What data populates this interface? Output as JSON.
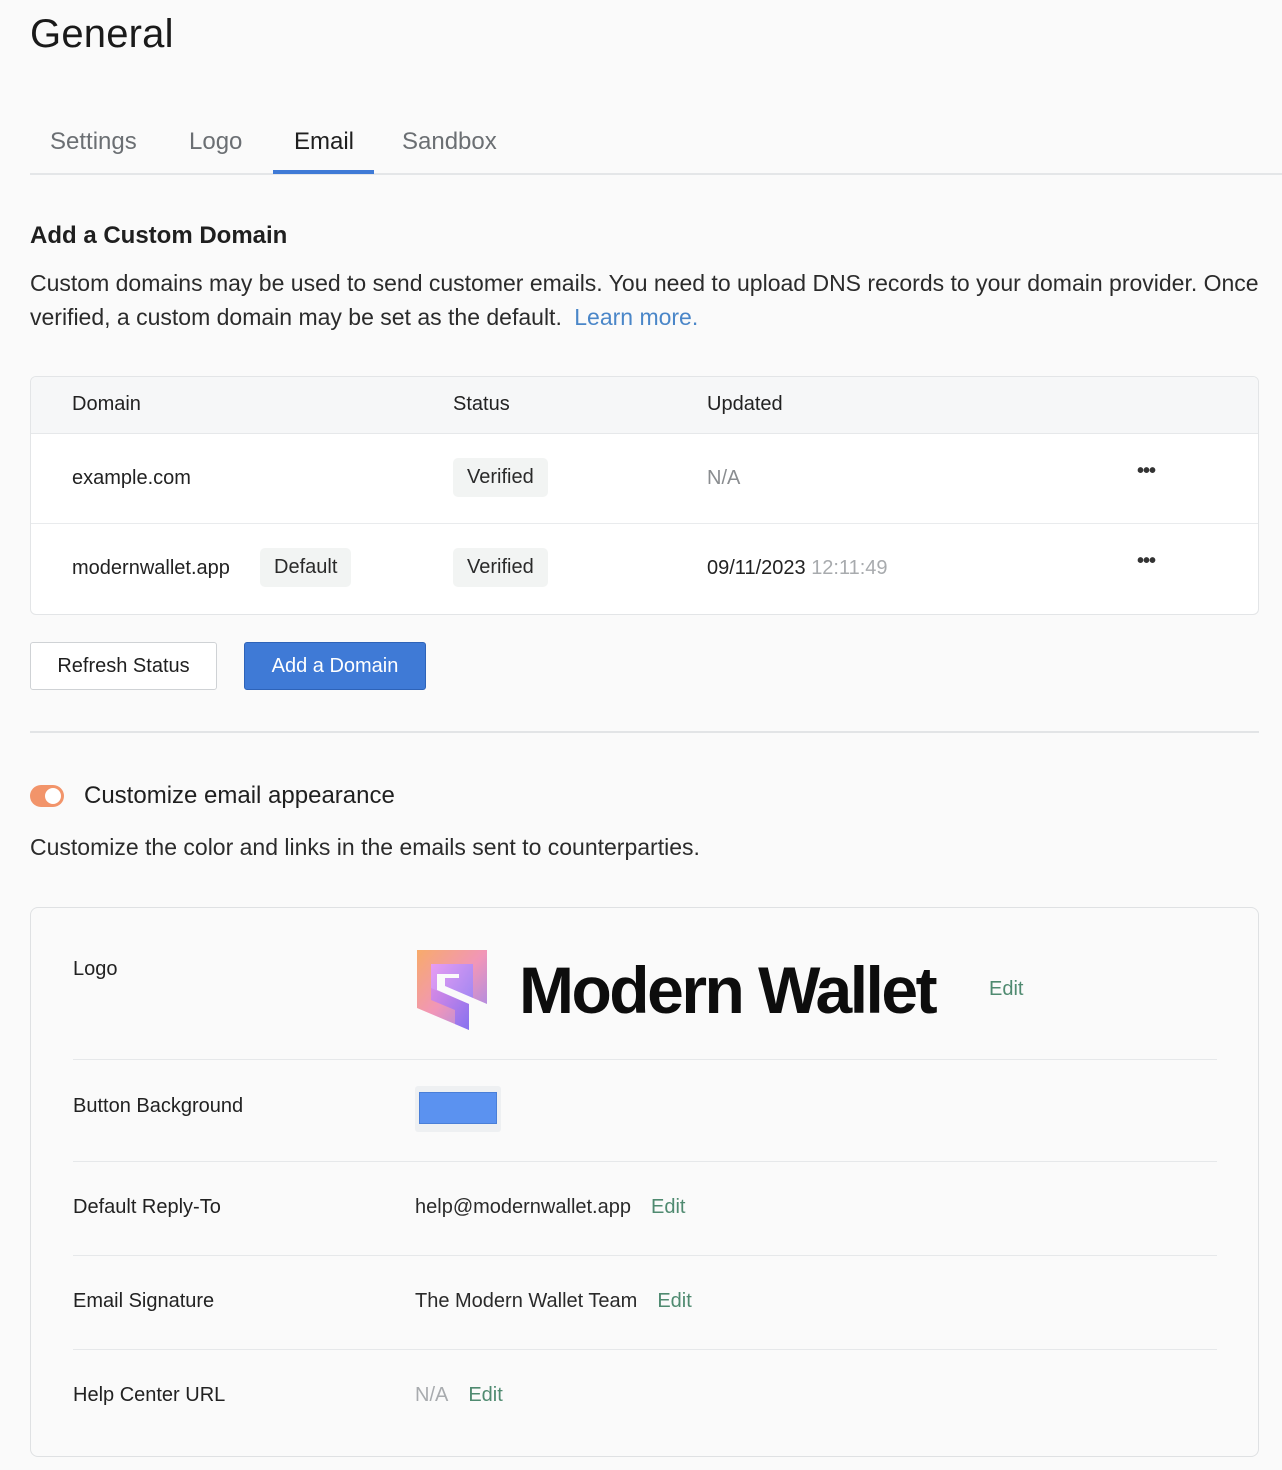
{
  "page": {
    "title": "General"
  },
  "tabs": [
    {
      "label": "Settings",
      "active": false
    },
    {
      "label": "Logo",
      "active": false
    },
    {
      "label": "Email",
      "active": true
    },
    {
      "label": "Sandbox",
      "active": false
    }
  ],
  "domain_section": {
    "title": "Add a Custom Domain",
    "description": "Custom domains may be used to send customer emails. You need to upload DNS records to your domain provider. Once verified, a custom domain may be set as the default.",
    "learn_more": "Learn more."
  },
  "domain_table": {
    "headers": {
      "domain": "Domain",
      "status": "Status",
      "updated": "Updated"
    },
    "rows": [
      {
        "domain": "example.com",
        "badge": "",
        "status": "Verified",
        "updated_date": "N/A",
        "updated_time": "",
        "menu": "•••"
      },
      {
        "domain": "modernwallet.app",
        "badge": "Default",
        "status": "Verified",
        "updated_date": "09/11/2023",
        "updated_time": "12:11:49",
        "menu": "•••"
      }
    ]
  },
  "buttons": {
    "refresh": "Refresh Status",
    "add_domain": "Add a Domain"
  },
  "customize": {
    "enabled": true,
    "title": "Customize email appearance",
    "description": "Customize the color and links in the emails sent to counterparties."
  },
  "settings_card": {
    "logo": {
      "label": "Logo",
      "brand_text": "Modern Wallet",
      "edit": "Edit"
    },
    "button_background": {
      "label": "Button Background",
      "color": "#5b92f0"
    },
    "reply_to": {
      "label": "Default Reply-To",
      "value": "help@modernwallet.app",
      "edit": "Edit"
    },
    "signature": {
      "label": "Email Signature",
      "value": "The Modern Wallet Team",
      "edit": "Edit"
    },
    "help_center": {
      "label": "Help Center URL",
      "value": "N/A",
      "edit": "Edit"
    }
  },
  "colors": {
    "accent": "#3f7ad6",
    "toggle_on": "#f2946a",
    "edit_link": "#4f8a70",
    "link": "#4a86c8"
  }
}
